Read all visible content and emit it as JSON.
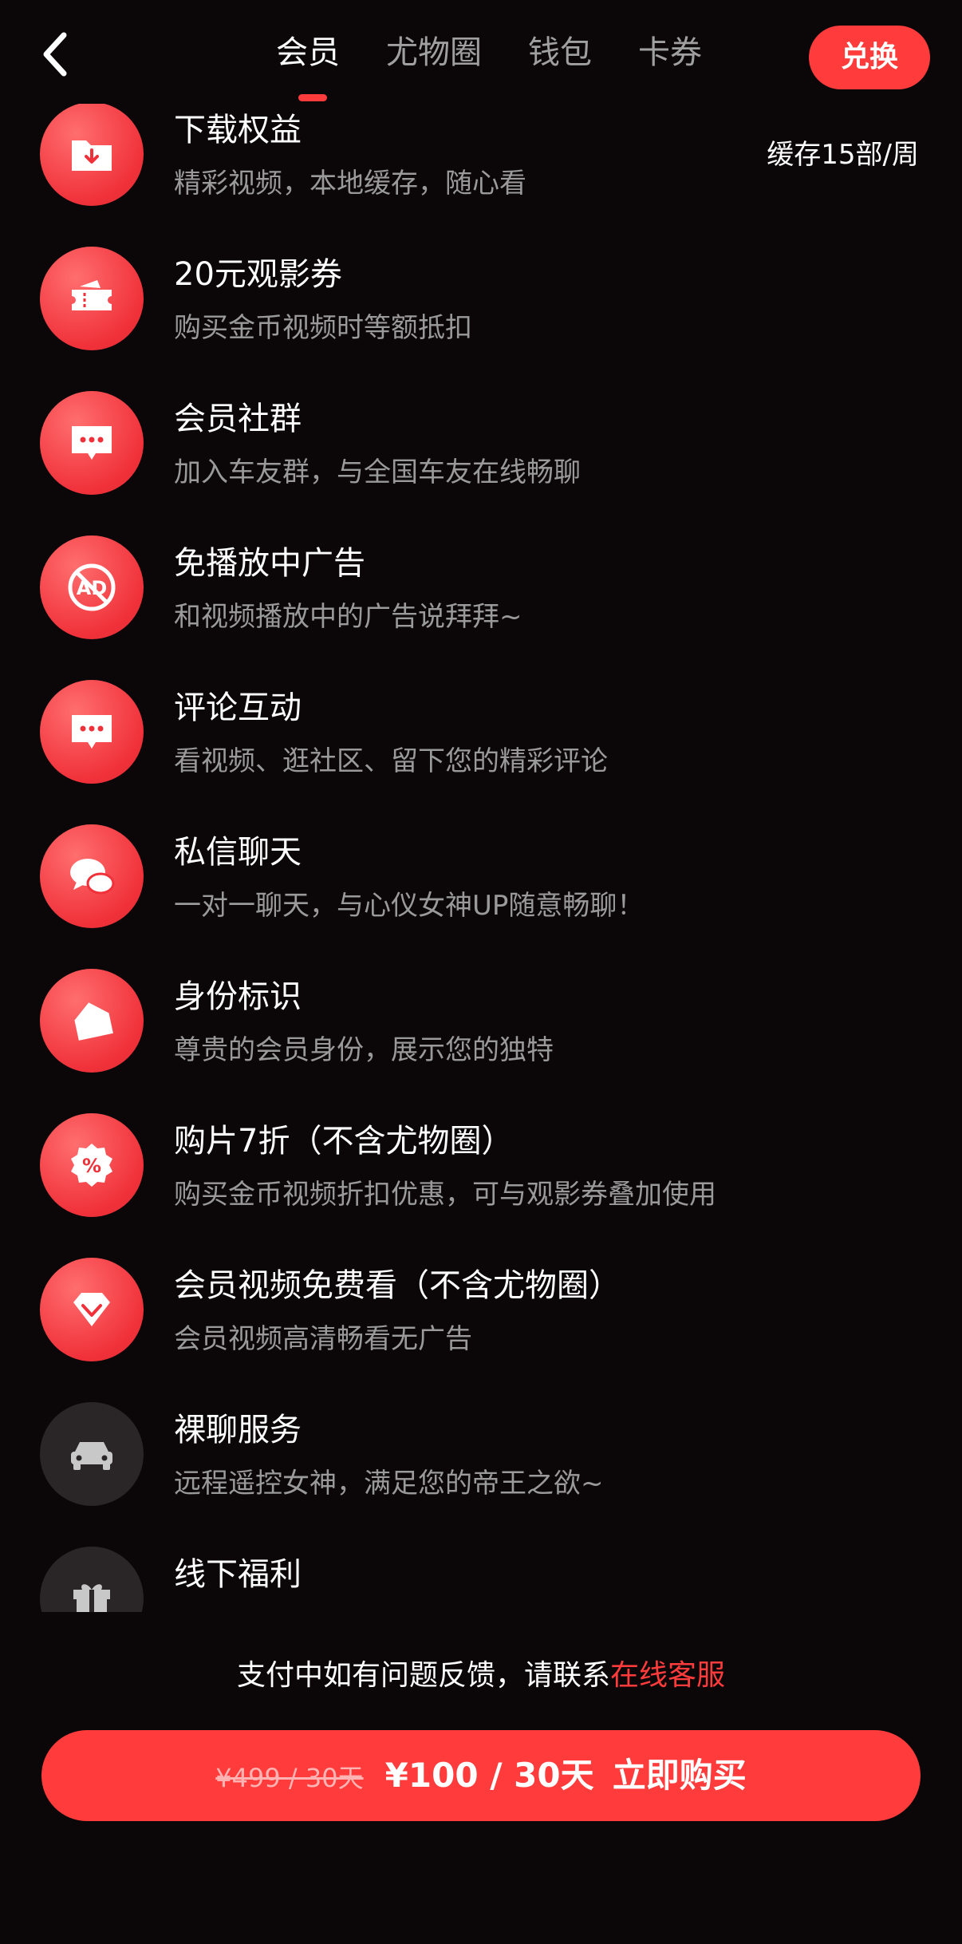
{
  "header": {
    "tabs": [
      "会员",
      "尤物圈",
      "钱包",
      "卡券"
    ],
    "active_tab": 0,
    "redeem_label": "兑换"
  },
  "benefits": [
    {
      "title": "下载权益",
      "desc": "精彩视频，本地缓存，随心看",
      "right": "缓存15部/周",
      "icon": "download-folder-icon"
    },
    {
      "title": "20元观影券",
      "desc": "购买金币视频时等额抵扣",
      "icon": "ticket-icon"
    },
    {
      "title": "会员社群",
      "desc": "加入车友群，与全国车友在线畅聊",
      "icon": "chat-bubble-icon"
    },
    {
      "title": "免播放中广告",
      "desc": "和视频播放中的广告说拜拜~",
      "icon": "no-ad-icon"
    },
    {
      "title": "评论互动",
      "desc": "看视频、逛社区、留下您的精彩评论",
      "icon": "comment-icon"
    },
    {
      "title": "私信聊天",
      "desc": "一对一聊天，与心仪女神UP随意畅聊！",
      "icon": "private-chat-icon"
    },
    {
      "title": "身份标识",
      "desc": "尊贵的会员身份，展示您的独特",
      "icon": "badge-tag-icon"
    },
    {
      "title": "购片7折（不含尤物圈）",
      "desc": "购买金币视频折扣优惠，可与观影券叠加使用",
      "icon": "discount-percent-icon"
    },
    {
      "title": "会员视频免费看（不含尤物圈）",
      "desc": "会员视频高清畅看无广告",
      "icon": "diamond-icon"
    },
    {
      "title": "裸聊服务",
      "desc": "远程遥控女神，满足您的帝王之欲~",
      "icon": "car-icon"
    },
    {
      "title": "线下福利",
      "desc": "",
      "icon": "gift-icon"
    }
  ],
  "support": {
    "text": "支付中如有问题反馈，请联系",
    "link": "在线客服"
  },
  "purchase": {
    "original_price": "¥499 / 30天",
    "price": "¥100 / 30天",
    "label": "立即购买"
  },
  "colors": {
    "background": "#0b0708",
    "accent": "#ff3b3b",
    "secondary_text": "#9a9a9a",
    "locked_icon_bg": "#2a2628"
  }
}
